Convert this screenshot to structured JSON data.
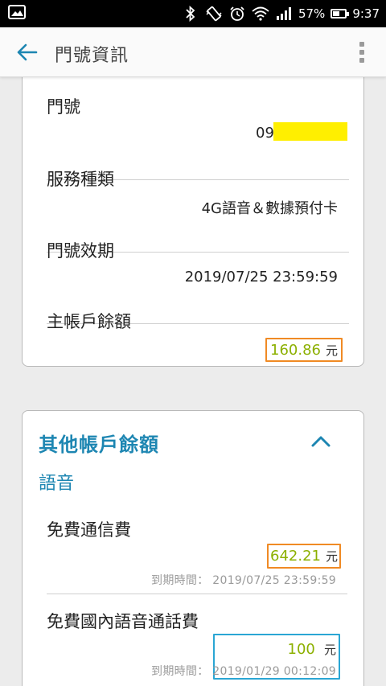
{
  "status_bar": {
    "battery": "57%",
    "time": "9:37",
    "battery_level": 0.57,
    "icons": [
      "image-icon",
      "bluetooth-icon",
      "vibrate-icon",
      "alarm-icon",
      "wifi-icon",
      "signal-icon",
      "battery-icon"
    ]
  },
  "app_bar": {
    "title": "門號資訊",
    "back_icon": "back-arrow-icon",
    "menu_icon": "more-vert-icon"
  },
  "number_card": {
    "rows": [
      {
        "label": "門號",
        "value": "09"
      },
      {
        "label": "服務種類",
        "value": "4G語音＆數據預付卡"
      },
      {
        "label": "門號效期",
        "value": "2019/07/25 23:59:59"
      },
      {
        "label": "主帳戶餘額",
        "amount": "160.86",
        "unit": "元"
      }
    ]
  },
  "other_balance": {
    "heading": "其他帳戶餘額",
    "section": "語音",
    "chevron_icon": "chevron-up-icon",
    "items": [
      {
        "label": "免費通信費",
        "amount": "642.21",
        "unit": "元",
        "expire_label": "到期時間：",
        "expire_value": "2019/07/25 23:59:59"
      },
      {
        "label": "免費國內語音通話費",
        "amount": "100",
        "unit": "元",
        "expire_label": "到期時間：",
        "expire_value": "2019/01/29 00:12:09"
      }
    ]
  },
  "colors": {
    "accent": "#1d86b2",
    "amount": "#8cb000",
    "orange_box": "#f08a24",
    "blue_box": "#2aa6d4",
    "highlight": "#ffef00"
  }
}
